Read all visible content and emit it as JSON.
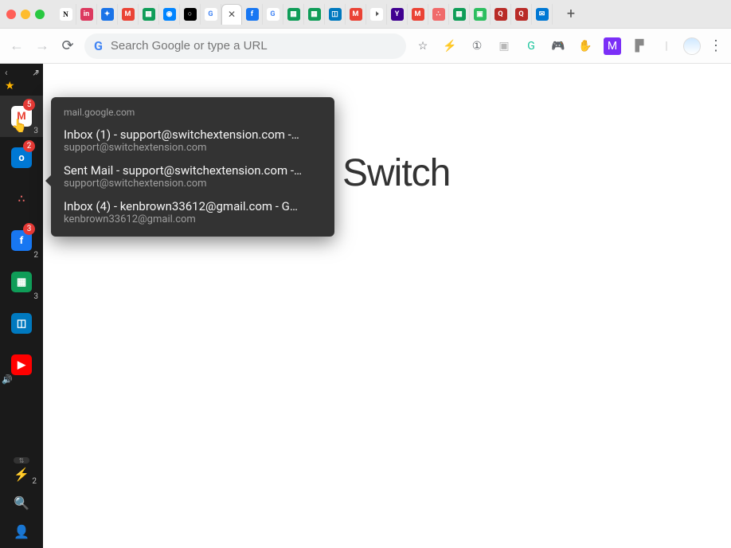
{
  "window": {
    "tabs": [
      {
        "name": "tab-notion",
        "glyph": "N",
        "bg": "#fff",
        "fg": "#000",
        "style": "serif"
      },
      {
        "name": "tab-invision",
        "glyph": "in",
        "bg": "#dc395f"
      },
      {
        "name": "tab-extension",
        "glyph": "✦",
        "bg": "#1a73e8"
      },
      {
        "name": "tab-gmail-1",
        "glyph": "M",
        "bg": "#ea4335"
      },
      {
        "name": "tab-sheets-1",
        "glyph": "▦",
        "bg": "#0f9d58"
      },
      {
        "name": "tab-messenger",
        "glyph": "◉",
        "bg": "#0084ff"
      },
      {
        "name": "tab-github",
        "glyph": "○",
        "bg": "#000"
      },
      {
        "name": "tab-google",
        "glyph": "G",
        "bg": "#fff",
        "fg": "#4285f4"
      },
      {
        "name": "tab-active",
        "active": true
      },
      {
        "name": "tab-facebook-1",
        "glyph": "f",
        "bg": "#1877f2"
      },
      {
        "name": "tab-google-2",
        "glyph": "G",
        "bg": "#fff",
        "fg": "#4285f4"
      },
      {
        "name": "tab-sheets-2",
        "glyph": "▦",
        "bg": "#0f9d58"
      },
      {
        "name": "tab-sheets-3",
        "glyph": "▦",
        "bg": "#0f9d58"
      },
      {
        "name": "tab-trello",
        "glyph": "◫",
        "bg": "#0079bf"
      },
      {
        "name": "tab-gmail-2",
        "glyph": "M",
        "bg": "#ea4335"
      },
      {
        "name": "tab-muted",
        "glyph": "🕨",
        "bg": "#fff",
        "fg": "#555"
      },
      {
        "name": "tab-yahoo",
        "glyph": "Y",
        "bg": "#400090"
      },
      {
        "name": "tab-gmail-3",
        "glyph": "M",
        "bg": "#ea4335"
      },
      {
        "name": "tab-asana",
        "glyph": "∴",
        "bg": "#f06a6a"
      },
      {
        "name": "tab-sheets-4",
        "glyph": "▦",
        "bg": "#0f9d58"
      },
      {
        "name": "tab-evernote",
        "glyph": "▣",
        "bg": "#2dbe60"
      },
      {
        "name": "tab-quora-1",
        "glyph": "Q",
        "bg": "#b92b27"
      },
      {
        "name": "tab-quora-2",
        "glyph": "Q",
        "bg": "#b92b27"
      },
      {
        "name": "tab-outlook",
        "glyph": "✉",
        "bg": "#0078d4"
      }
    ]
  },
  "toolbar": {
    "omnibox_placeholder": "Search Google or type a URL",
    "ext": [
      {
        "name": "star-icon",
        "glyph": "☆",
        "fg": "#5f6368"
      },
      {
        "name": "switch-ext-icon",
        "glyph": "⚡",
        "fg": "#000"
      },
      {
        "name": "onetab-icon",
        "glyph": "①",
        "fg": "#5f6368"
      },
      {
        "name": "toggl-icon",
        "glyph": "▣",
        "fg": "#b7b7b7"
      },
      {
        "name": "grammarly-icon",
        "glyph": "G",
        "fg": "#15c39a"
      },
      {
        "name": "controller-icon",
        "glyph": "🎮",
        "fg": "#d66"
      },
      {
        "name": "hand-icon",
        "glyph": "✋",
        "fg": "#b7b7b7"
      },
      {
        "name": "m-ext-icon",
        "glyph": "M",
        "fg": "#fff",
        "bg": "#7b2ff7"
      },
      {
        "name": "flag-icon",
        "glyph": "▛",
        "fg": "#888"
      },
      {
        "name": "bar-icon",
        "glyph": "|",
        "fg": "#ccc"
      }
    ]
  },
  "sidebar": {
    "items": [
      {
        "name": "gmail",
        "label": "Gmail",
        "glyph": "M",
        "bg": "#fff",
        "fg": "#ea4335",
        "badge": "5",
        "count": "3",
        "active": true
      },
      {
        "name": "outlook",
        "label": "Outlook",
        "glyph": "o",
        "bg": "#0078d4",
        "badge": "2",
        "count": ""
      },
      {
        "name": "asana",
        "label": "Asana",
        "glyph": "∴",
        "bg": "transparent",
        "fg": "#f06a6a",
        "badge": "",
        "count": ""
      },
      {
        "name": "facebook",
        "label": "Facebook",
        "glyph": "f",
        "bg": "#1877f2",
        "badge": "3",
        "count": "2"
      },
      {
        "name": "sheets",
        "label": "Sheets",
        "glyph": "▦",
        "bg": "#0f9d58",
        "badge": "",
        "count": "3"
      },
      {
        "name": "trello",
        "label": "Trello",
        "glyph": "◫",
        "bg": "#0079bf",
        "badge": "",
        "count": ""
      },
      {
        "name": "youtube",
        "label": "YouTube",
        "glyph": "▶",
        "bg": "#ff0000",
        "badge": "",
        "count": ""
      }
    ],
    "bottom": [
      {
        "name": "switch-home",
        "glyph": "⚡",
        "count": "2"
      },
      {
        "name": "search",
        "glyph": "🔍",
        "count": ""
      },
      {
        "name": "profile",
        "glyph": "👤",
        "count": ""
      }
    ]
  },
  "popover": {
    "domain": "mail.google.com",
    "entries": [
      {
        "title": "Inbox (1) - support@switchextension.com -…",
        "sub": "support@switchextension.com"
      },
      {
        "title": "Sent Mail - support@switchextension.com -…",
        "sub": "support@switchextension.com"
      },
      {
        "title": "Inbox (4) - kenbrown33612@gmail.com - G…",
        "sub": "kenbrown33612@gmail.com"
      }
    ]
  },
  "page": {
    "logo": "Switch"
  }
}
